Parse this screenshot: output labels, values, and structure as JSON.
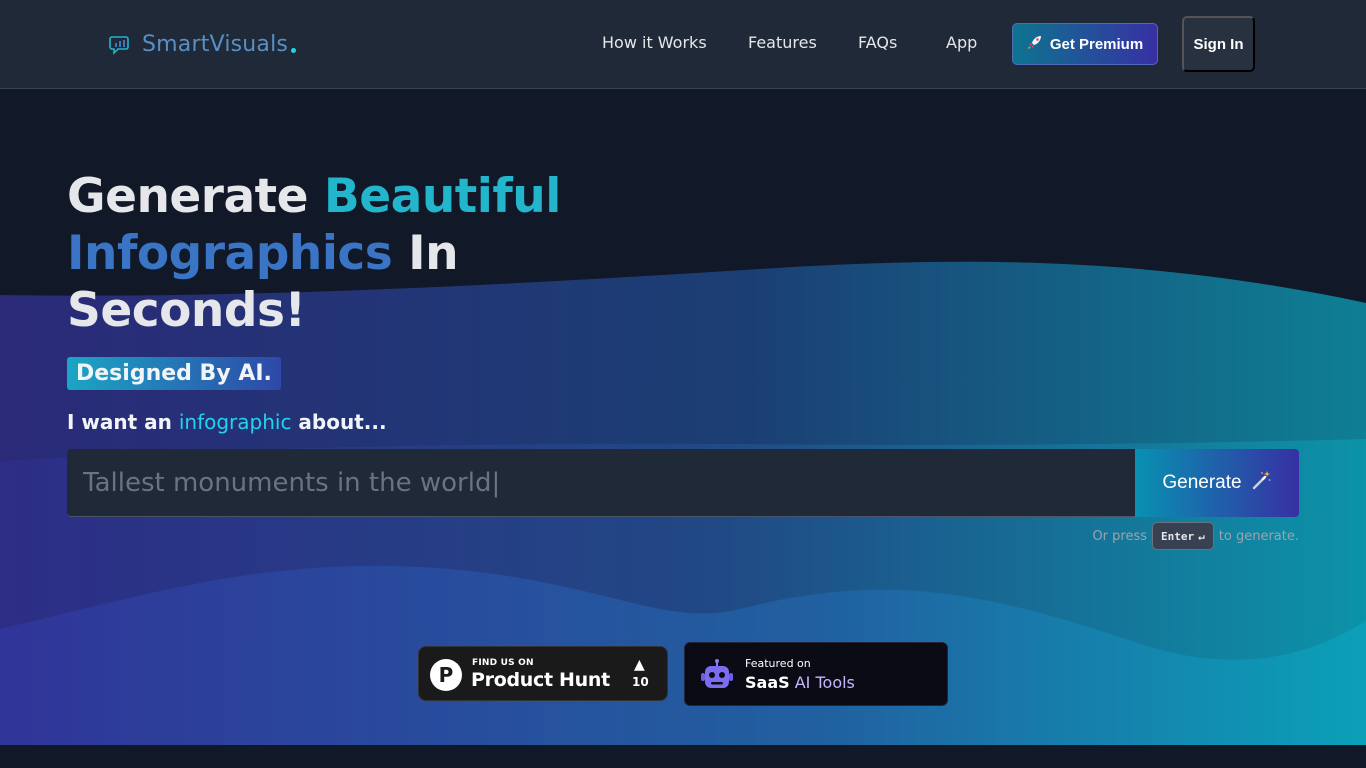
{
  "brand": {
    "name": "SmartVisuals",
    "icon": "chat-bubble-icon"
  },
  "nav": {
    "links": [
      "How it Works",
      "Features",
      "FAQs",
      "App"
    ],
    "premium_label": "Get Premium",
    "premium_icon": "rocket-icon",
    "signin_label": "Sign In"
  },
  "hero": {
    "line1_a": "Generate ",
    "line1_b": "Beautiful",
    "line2_a": "Infographics",
    "line2_b": " In",
    "line3": "Seconds!",
    "badge": "Designed By AI.",
    "prompt_a": "I want an ",
    "prompt_b": "infographic",
    "prompt_c": " about..."
  },
  "search": {
    "placeholder": "Tallest monuments in the world|",
    "generate_label": "Generate",
    "generate_icon": "magic-wand-icon",
    "hint_before": "Or press",
    "key_label": "Enter",
    "key_icon": "return-icon",
    "hint_after": "to generate."
  },
  "badges": {
    "producthunt": {
      "small": "FIND US ON",
      "big": "Product Hunt",
      "count": "10",
      "logo": "P"
    },
    "saas": {
      "small": "Featured on",
      "big_a": "SaaS",
      "big_b": " AI Tools",
      "icon": "robot-icon"
    }
  },
  "colors": {
    "accent_cyan": "#22b5cc",
    "accent_blue": "#3a74c4",
    "background": "#111827",
    "header": "#1f2937"
  }
}
